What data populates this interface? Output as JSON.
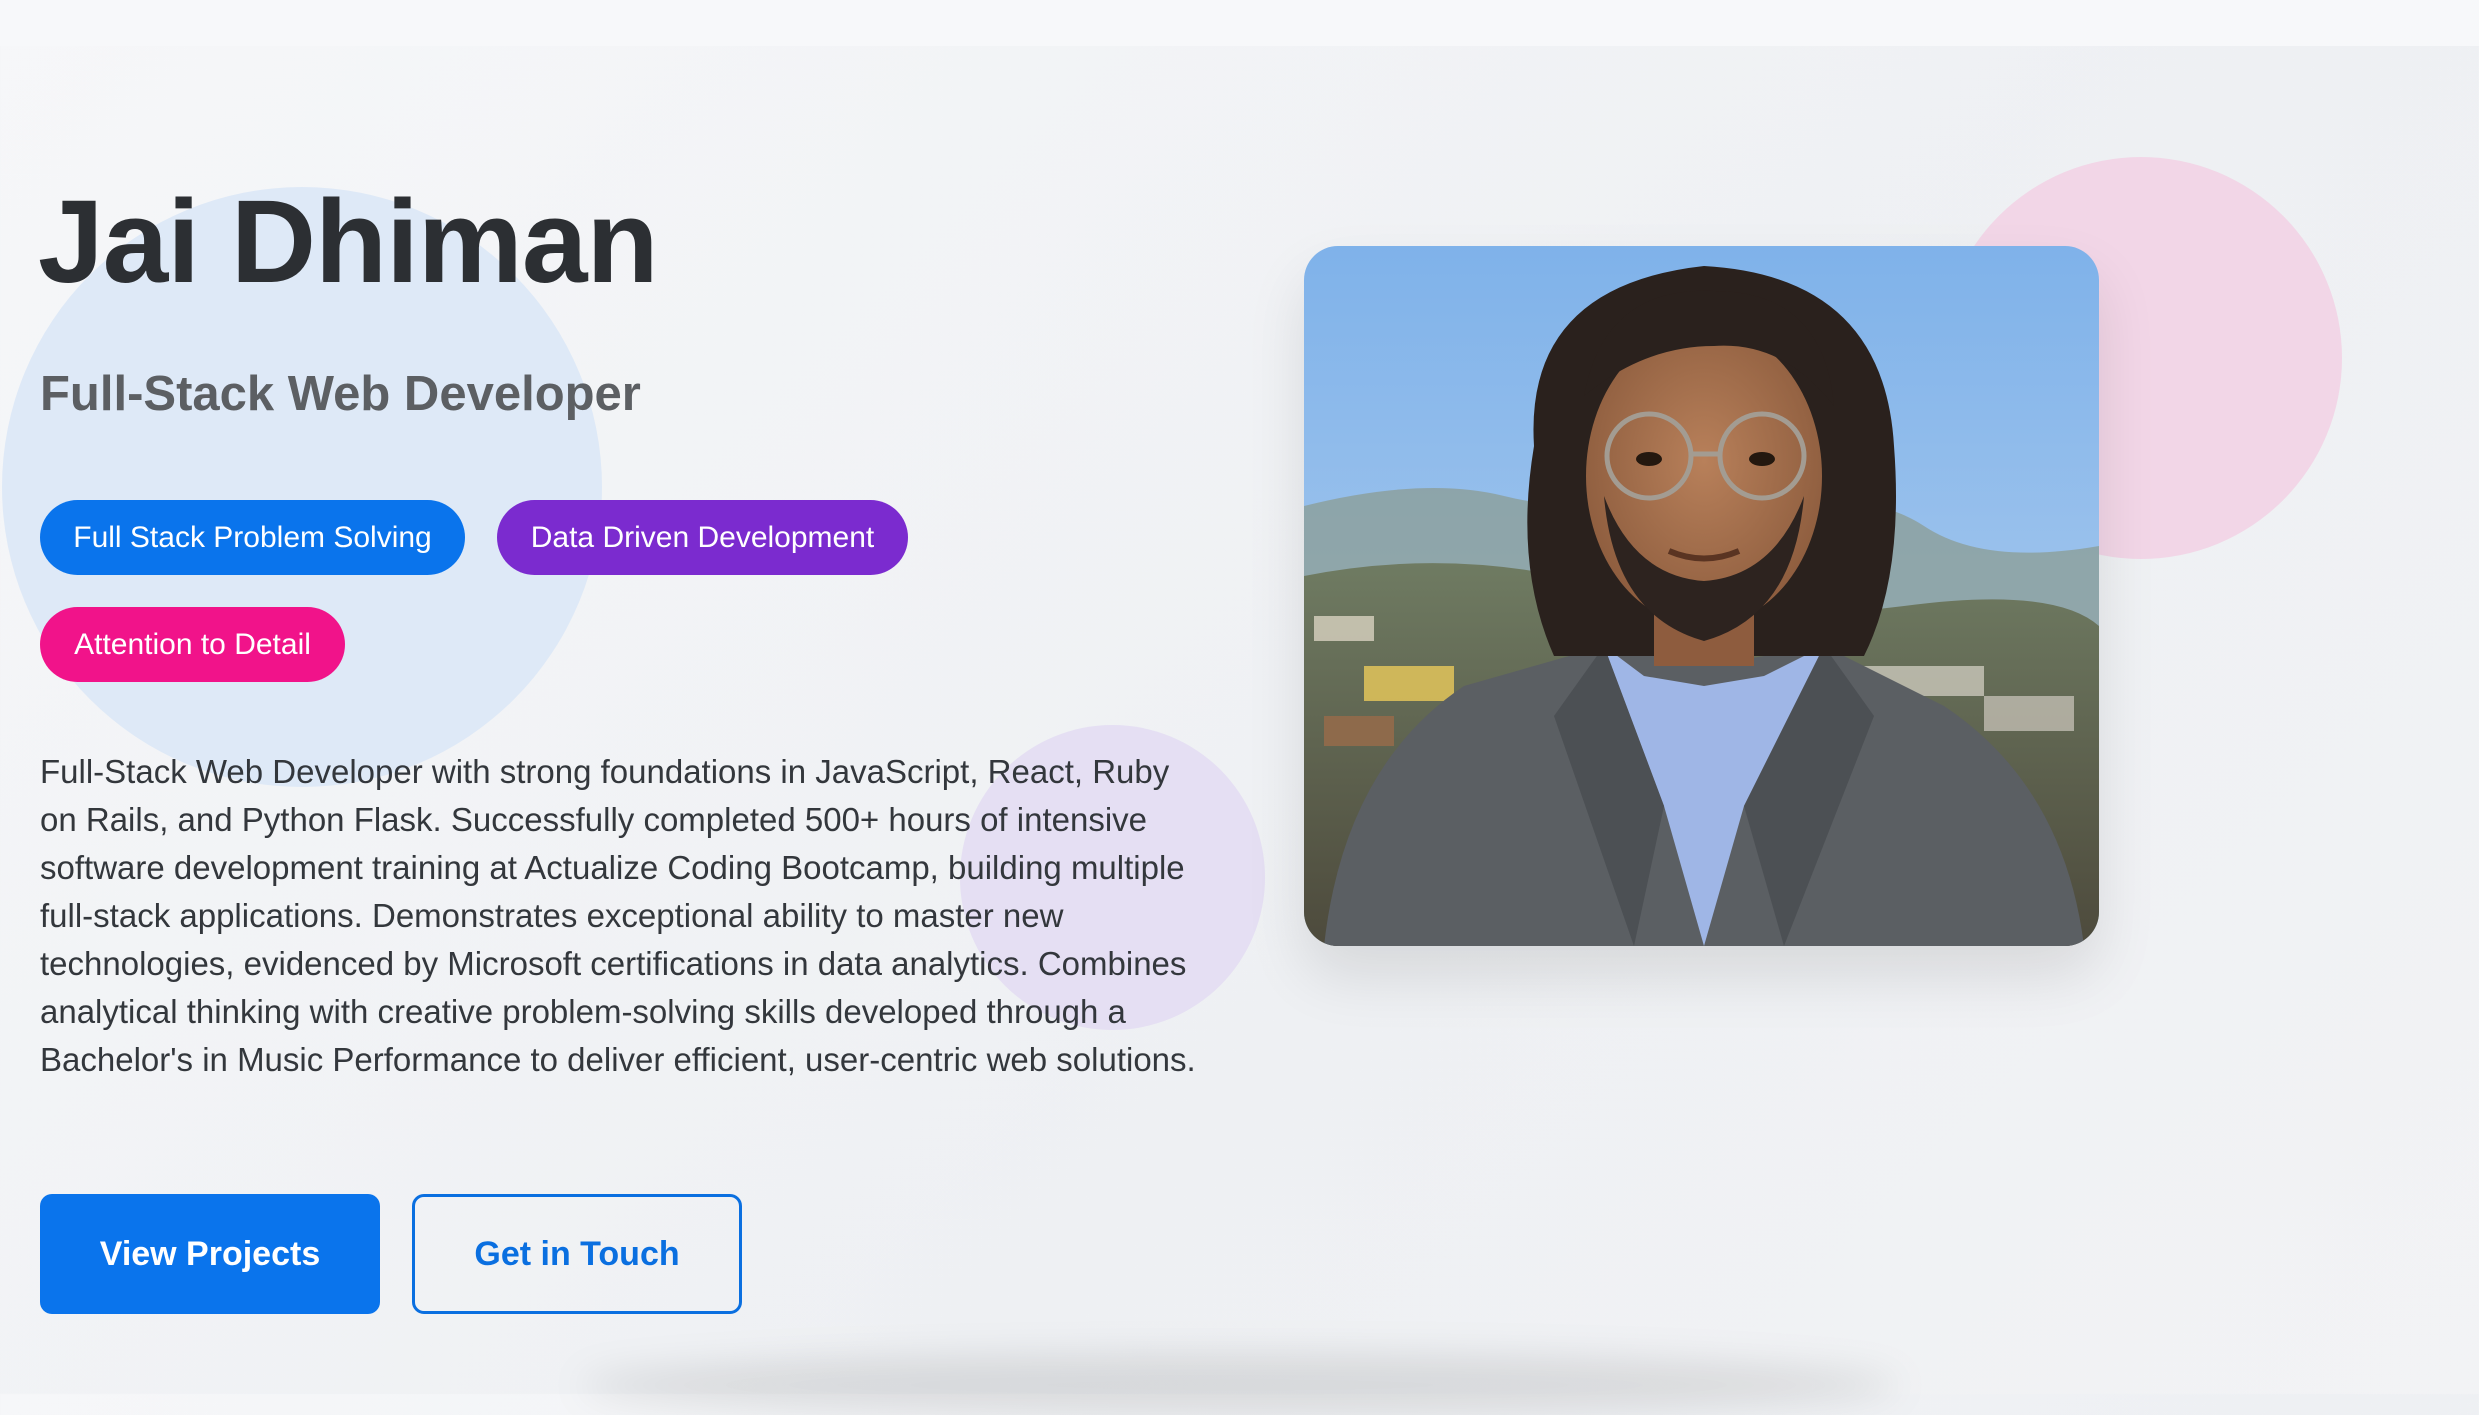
{
  "hero": {
    "name": "Jai Dhiman",
    "title": "Full-Stack Web Developer",
    "tags": [
      {
        "label": "Full Stack Problem Solving",
        "color": "#0a74ec"
      },
      {
        "label": "Data Driven Development",
        "color": "#7b2bcf"
      },
      {
        "label": "Attention to Detail",
        "color": "#f1138a"
      }
    ],
    "bio": "Full-Stack Web Developer with strong foundations in JavaScript, React, Ruby on Rails, and Python Flask. Successfully completed 500+ hours of intensive software development training at Actualize Coding Bootcamp, building multiple full-stack applications. Demonstrates exceptional ability to master new technologies, evidenced by Microsoft certifications in data analytics. Combines analytical thinking with creative problem-solving skills developed through a Bachelor's in Music Performance to deliver efficient, user-centric web solutions.",
    "buttons": {
      "primary": "View Projects",
      "secondary": "Get in Touch"
    }
  },
  "colors": {
    "accent": "#0a74ec",
    "purple": "#7b2bcf",
    "pink": "#f1138a"
  }
}
